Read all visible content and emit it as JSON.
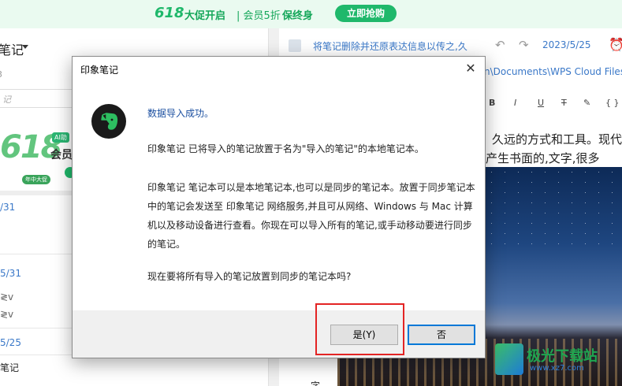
{
  "promo": {
    "tag": "618",
    "main": "大促开启",
    "sub": "| 会员5折",
    "highlight": "保终身",
    "button": "立即抢购"
  },
  "left": {
    "notebook_title": "笔记",
    "notebook_sub": "3",
    "search_placeholder": "记",
    "ad": {
      "big": "618",
      "tag": "AI助",
      "text": "会员",
      "stamp": "年中大促"
    },
    "rows": [
      {
        "text": "/31",
        "kind": "date"
      },
      {
        "text": "5/31",
        "kind": "date"
      },
      {
        "text": "≷v",
        "kind": "muted"
      },
      {
        "text": "≷v",
        "kind": "muted"
      },
      {
        "text": "5/25",
        "kind": "date"
      },
      {
        "text": "笔记",
        "kind": "normal"
      }
    ]
  },
  "right": {
    "note_title": "将笔记删除并还原表达信息以传之,久",
    "undo": "↶",
    "redo": "↷",
    "date": "2023/5/25",
    "alarm": "⏰",
    "path": "n\\Documents\\WPS Cloud Files",
    "toolbar": [
      "B",
      "I",
      "U",
      "T",
      "✎",
      "{ }"
    ],
    "text_line1": "久远的方式和工具。现代",
    "text_line2": "产生书面的,文字,很多",
    "bottom_char": "字"
  },
  "watermark": {
    "title": "极光下载站",
    "url": "www.xz7.com"
  },
  "dialog": {
    "title": "印象笔记",
    "close": "✕",
    "heading": "数据导入成功。",
    "para1": "印象笔记 已将导入的笔记放置于名为\"导入的笔记\"的本地笔记本。",
    "para2": "印象笔记 笔记本可以是本地笔记本,也可以是同步的笔记本。放置于同步笔记本中的笔记会发送至 印象笔记 网络服务,并且可从网络、Windows 与 Mac 计算机以及移动设备进行查看。你现在可以导入所有的笔记,或手动移动要进行同步的笔记。",
    "para3": "现在要将所有导入的笔记放置到同步的笔记本吗?",
    "yes_label": "是(Y)",
    "no_label": "否"
  },
  "colors": {
    "accent": "#1fb86b",
    "link": "#3a78c8",
    "highlight_border": "#e32424",
    "default_button_border": "#0078d7"
  }
}
